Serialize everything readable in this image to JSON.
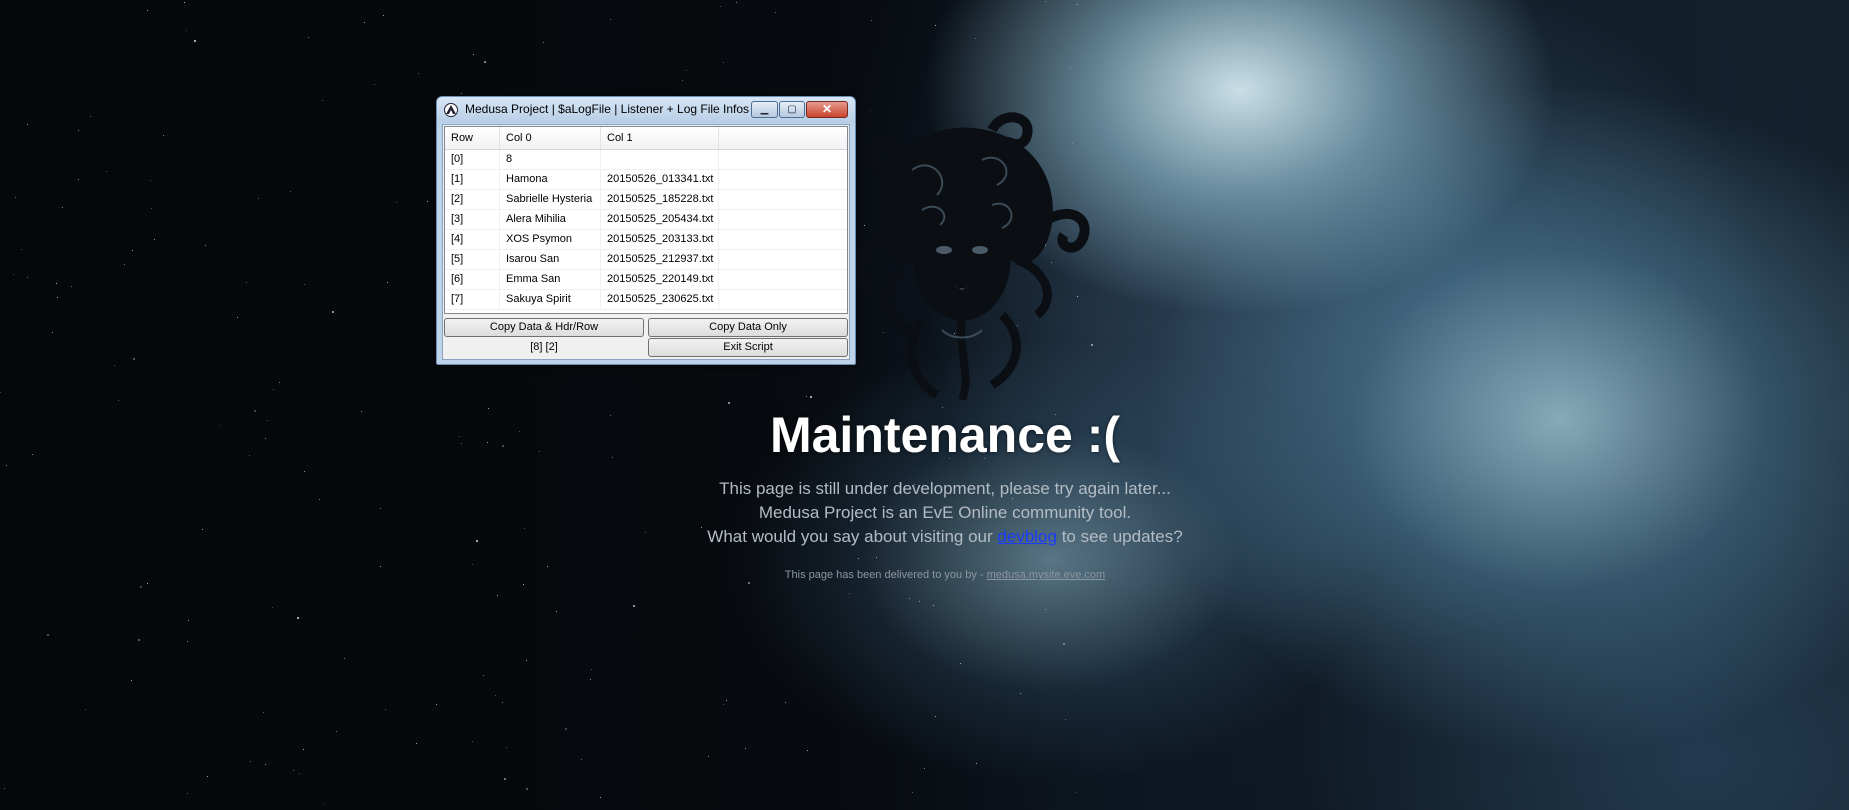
{
  "window": {
    "title": "Medusa Project | $aLogFile | Listener + Log File Infos",
    "minimize_glyph": "▁",
    "maximize_glyph": "▢",
    "close_glyph": "✕",
    "icon": "autoit-icon"
  },
  "list": {
    "headers": [
      "Row",
      "Col 0",
      "Col 1",
      ""
    ],
    "rows": [
      [
        "[0]",
        "8",
        ""
      ],
      [
        "[1]",
        "Hamona",
        "20150526_013341.txt"
      ],
      [
        "[2]",
        "Sabrielle Hysteria",
        "20150525_185228.txt"
      ],
      [
        "[3]",
        "Alera Mihilia",
        "20150525_205434.txt"
      ],
      [
        "[4]",
        "XOS Psymon",
        "20150525_203133.txt"
      ],
      [
        "[5]",
        "Isarou San",
        "20150525_212937.txt"
      ],
      [
        "[6]",
        "Emma San",
        "20150525_220149.txt"
      ],
      [
        "[7]",
        "Sakuya Spirit",
        "20150525_230625.txt"
      ]
    ]
  },
  "buttons": {
    "copy_data_hdr_row": "Copy Data & Hdr/Row",
    "copy_data_only": "Copy Data Only",
    "exit_script": "Exit Script"
  },
  "status": {
    "dimensions": "[8] [2]"
  },
  "page": {
    "title": "Maintenance :(",
    "line1": "This page is still under development, please try again later...",
    "line2": "Medusa Project is an EvE Online community tool.",
    "line3_before": "What would you say about visiting our ",
    "line3_link": "devblog",
    "line3_after": " to see updates?",
    "credit_before": "This page has been delivered to you by - ",
    "credit_link": "medusa.mysite.eve.com"
  },
  "colors": {
    "link": "#1a3cff",
    "title_text": "#ffffff",
    "body_text": "#b3bcc4",
    "window_frame": "#bcd3ea",
    "close_button": "#c9452f"
  }
}
